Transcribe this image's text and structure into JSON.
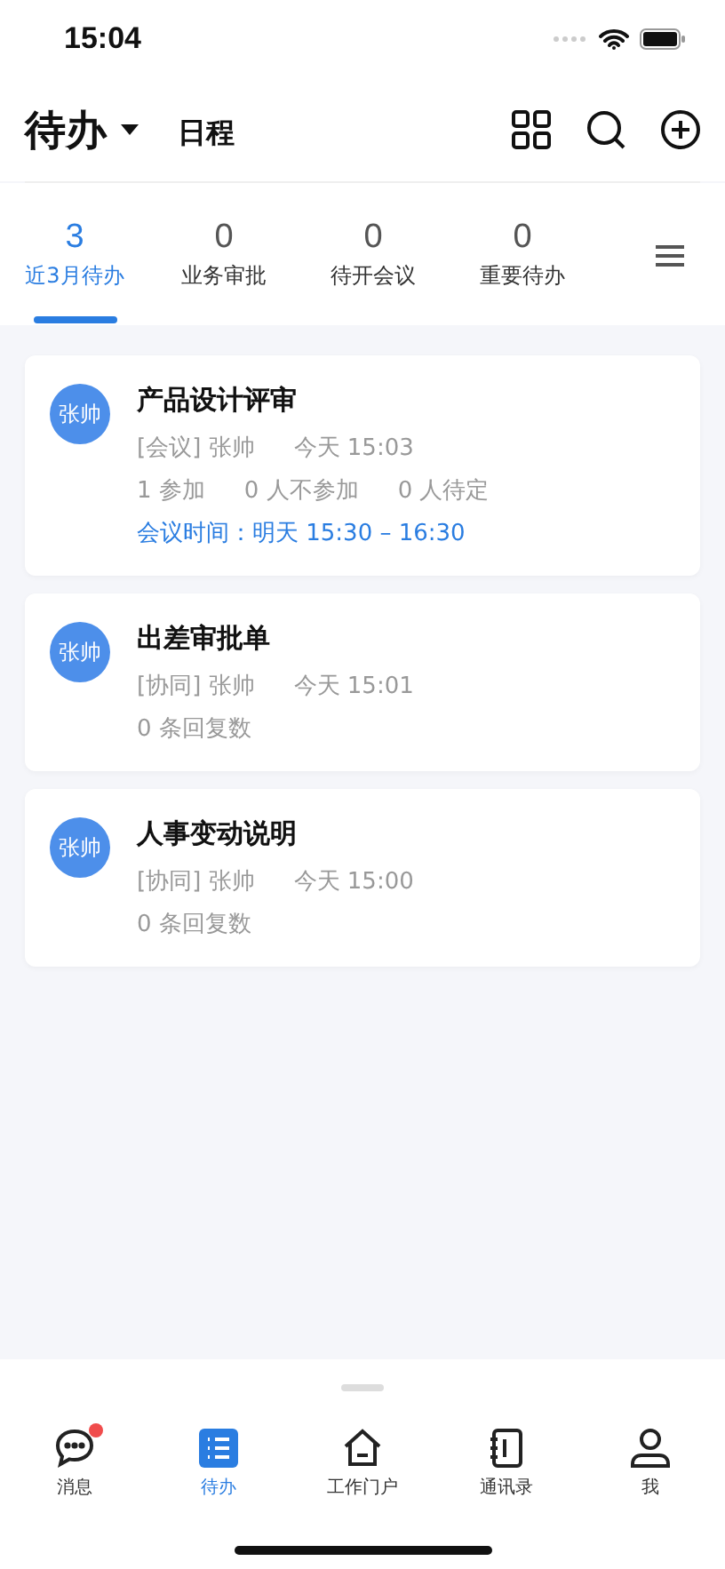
{
  "status_bar": {
    "time": "15:04"
  },
  "header": {
    "title": "待办",
    "secondary": "日程"
  },
  "tabs": [
    {
      "count": "3",
      "label": "近3月待办",
      "selected": true
    },
    {
      "count": "0",
      "label": "业务审批",
      "selected": false
    },
    {
      "count": "0",
      "label": "待开会议",
      "selected": false
    },
    {
      "count": "0",
      "label": "重要待办",
      "selected": false
    }
  ],
  "cards": [
    {
      "avatar": "张帅",
      "title": "产品设计评审",
      "lines": [
        {
          "kind": "meta",
          "parts": [
            "[会议] 张帅",
            "今天 15:03"
          ]
        },
        {
          "kind": "meta",
          "parts": [
            "1 参加",
            "0 人不参加",
            "0 人待定"
          ]
        },
        {
          "kind": "highlight",
          "parts": [
            "会议时间：明天 15:30 – 16:30"
          ]
        }
      ]
    },
    {
      "avatar": "张帅",
      "title": "出差审批单",
      "lines": [
        {
          "kind": "meta",
          "parts": [
            "[协同] 张帅",
            "今天 15:01"
          ]
        },
        {
          "kind": "meta",
          "parts": [
            "0 条回复数"
          ]
        }
      ]
    },
    {
      "avatar": "张帅",
      "title": "人事变动说明",
      "lines": [
        {
          "kind": "meta",
          "parts": [
            "[协同] 张帅",
            "今天 15:00"
          ]
        },
        {
          "kind": "meta",
          "parts": [
            "0 条回复数"
          ]
        }
      ]
    }
  ],
  "bottom_nav": [
    {
      "kind": "chat",
      "label": "消息",
      "selected": false,
      "badge": true
    },
    {
      "kind": "list",
      "label": "待办",
      "selected": true,
      "badge": false
    },
    {
      "kind": "home",
      "label": "工作门户",
      "selected": false,
      "badge": false
    },
    {
      "kind": "book",
      "label": "通讯录",
      "selected": false,
      "badge": false
    },
    {
      "kind": "person",
      "label": "我",
      "selected": false,
      "badge": false
    }
  ]
}
